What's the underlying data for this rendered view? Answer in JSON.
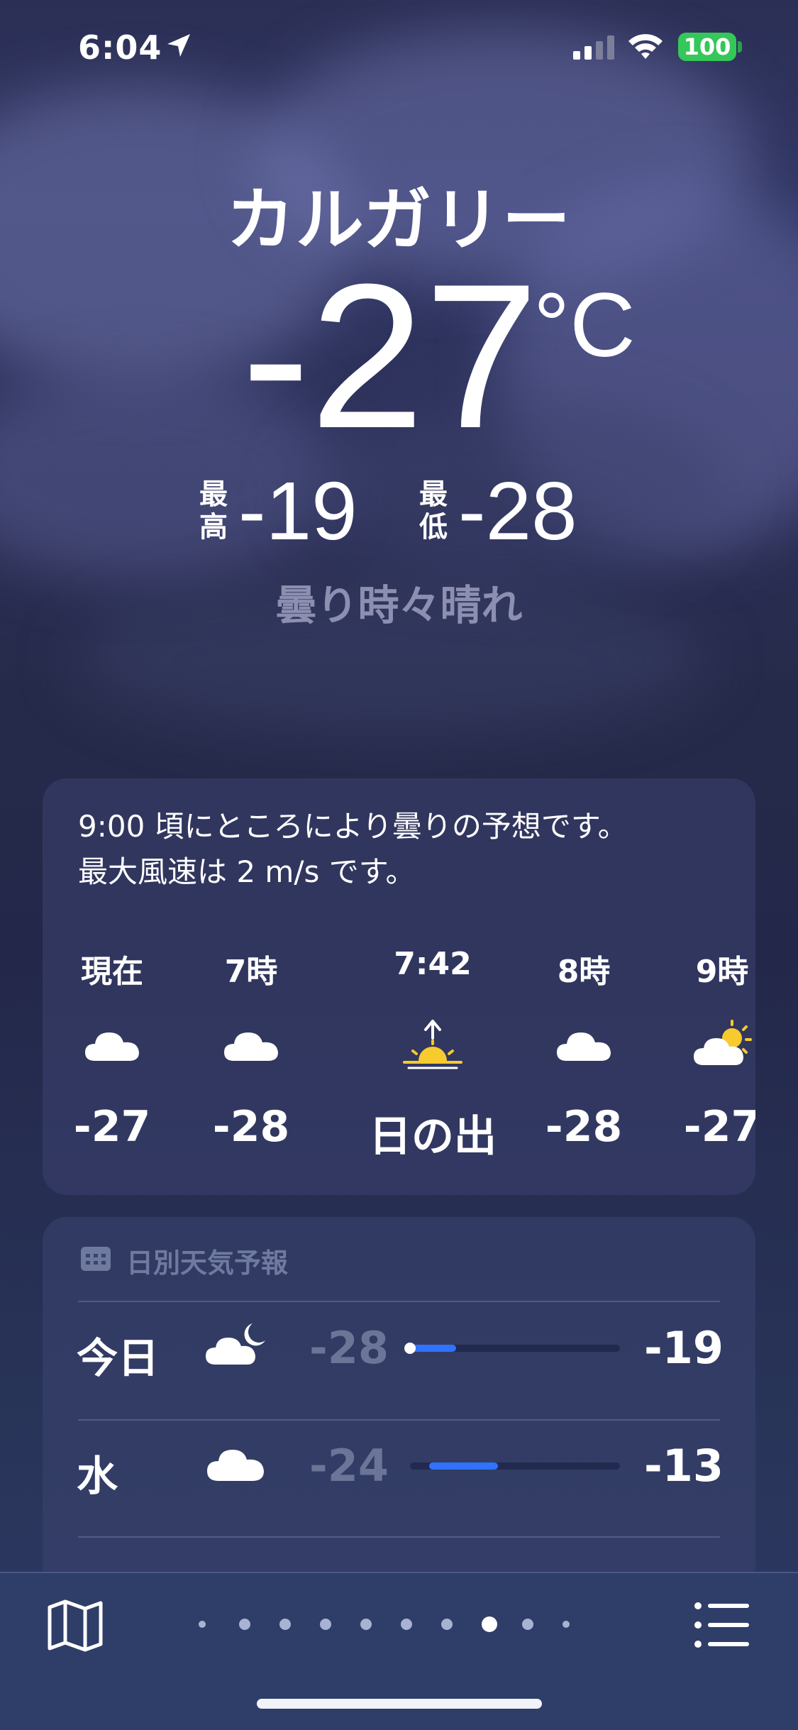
{
  "status_bar": {
    "time": "6:04",
    "battery": "100",
    "battery_color": "#35c759"
  },
  "hero": {
    "city": "カルガリー",
    "temperature": "-27",
    "unit": "°C",
    "high_label": "最高",
    "high_value": "-19",
    "low_label": "最低",
    "low_value": "-28",
    "condition": "曇り時々晴れ"
  },
  "hourly": {
    "summary_line1": "9:00 頃にところにより曇りの予想です。",
    "summary_line2": "最大風速は 2 m/s です。",
    "items": [
      {
        "label": "現在",
        "icon": "cloud-icon",
        "value": "-27"
      },
      {
        "label": "7時",
        "icon": "cloud-icon",
        "value": "-28"
      },
      {
        "label": "7:42",
        "icon": "sunrise-icon",
        "value": "日の出"
      },
      {
        "label": "8時",
        "icon": "cloud-icon",
        "value": "-28"
      },
      {
        "label": "9時",
        "icon": "partly-sunny-icon",
        "value": "-27"
      }
    ]
  },
  "daily": {
    "header": "日別天気予報",
    "days": [
      {
        "name": "今日",
        "icon": "partly-cloudy-night-icon",
        "low": "-28",
        "high": "-19",
        "range_start": 0.0,
        "range_end": 0.22,
        "current_marker": true
      },
      {
        "name": "水",
        "icon": "cloud-icon",
        "low": "-24",
        "high": "-13",
        "range_start": 0.09,
        "range_end": 0.42,
        "current_marker": false
      }
    ],
    "bar_color": "#2f73ff"
  },
  "bottom_bar": {
    "page_count": 10,
    "active_page": 8
  }
}
